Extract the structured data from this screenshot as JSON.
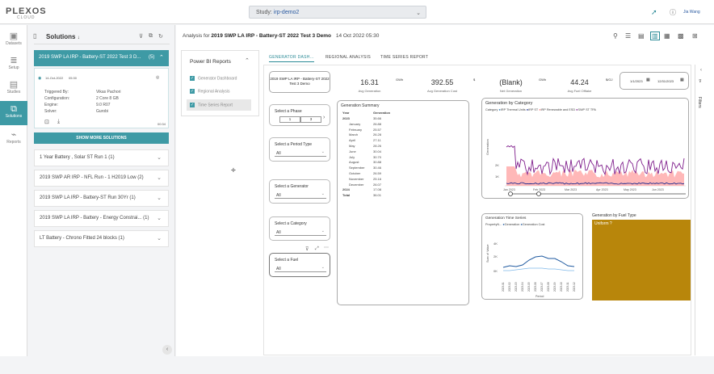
{
  "app": {
    "logo": "PLEXOS",
    "logo_sub": "CLOUD",
    "study_label": "Study:",
    "study_value": "irp-demo2",
    "user": "Jia Wang"
  },
  "nav": [
    {
      "label": "Datasets",
      "icon": "datasets-icon"
    },
    {
      "label": "Setup",
      "icon": "setup-icon"
    },
    {
      "label": "Studies",
      "icon": "studies-icon"
    },
    {
      "label": "Solutions",
      "icon": "solutions-icon"
    },
    {
      "label": "Reports",
      "icon": "reports-icon"
    }
  ],
  "solutions": {
    "title": "Solutions",
    "selected": {
      "title": "2019 SWP LA IRP - Battery-ST 2022 Test 3 D...",
      "count": "(5)",
      "date": "14-Oct-2022",
      "time": "05:30",
      "triggered_by_label": "Triggered By:",
      "triggered_by": "Vikas Pachori",
      "configuration_label": "Configuration:",
      "configuration": "2 Core 8 GB",
      "engine_label": "Engine:",
      "engine": "9.0 R07",
      "solver_label": "Solver:",
      "solver": "Gurobi",
      "duration": "00:34"
    },
    "show_more": "SHOW MORE SOLUTIONS",
    "items": [
      {
        "label": "1 Year Battery , Solar ST Run 1 (1)"
      },
      {
        "label": "2019 SWP AR IRP - NFL Run - 1 H2019 Low (2)"
      },
      {
        "label": "2019 SWP LA IRP - Battery-ST Run 30Yr (1)"
      },
      {
        "label": "2019 SWP LA IRP - Battery - Energy Constrai... (1)"
      },
      {
        "label": "LT Battery - Chrono Fitted 24 blocks (1)"
      }
    ]
  },
  "analysis": {
    "prefix": "Analysis for",
    "title": "2019 SWP LA IRP - Battery-ST 2022 Test 3 Demo",
    "date": "14 Oct 2022 05:30"
  },
  "powerbi": {
    "title": "Power BI Reports",
    "items": [
      {
        "label": "Generator Dashboard"
      },
      {
        "label": "Regional Analysis"
      },
      {
        "label": "Time Series Report"
      }
    ]
  },
  "tabs": [
    {
      "label": "GENERATOR DASH..."
    },
    {
      "label": "REGIONAL ANALYSIS"
    },
    {
      "label": "TIME SERIES REPORT"
    }
  ],
  "report": {
    "model_box": "2019 SWP LA IRP - Battery-ST 2022 Test 3 Demo",
    "kpis": [
      {
        "value": "16.31",
        "unit": "GWh",
        "label": "Avg Generation"
      },
      {
        "value": "392.55",
        "unit": "$",
        "label": "Avg Generation Cost"
      },
      {
        "value": "(Blank)",
        "unit": "GWh",
        "label": "Net Generation"
      },
      {
        "value": "44.24",
        "unit": "$/GJ",
        "label": "Avg Fuel Offtake"
      }
    ],
    "date_from": "1/1/2023",
    "date_to": "12/31/2023",
    "phase": {
      "title": "Select a Phase",
      "opt1": "1",
      "opt2": "3"
    },
    "period": {
      "title": "Select a Period Type",
      "value": "All"
    },
    "generator": {
      "title": "Select a Generator",
      "value": "All"
    },
    "category": {
      "title": "Select a Category",
      "value": "All"
    },
    "fuel": {
      "title": "Select a Fuel",
      "value": "All"
    },
    "gen_summary": {
      "title": "Generation Summary",
      "col_year": "Year",
      "col_gen": "Generation",
      "rows": [
        {
          "label": "2023",
          "value": "35.66"
        },
        {
          "label": "January",
          "value": "26.88"
        },
        {
          "label": "February",
          "value": "25.57"
        },
        {
          "label": "March",
          "value": "26.28"
        },
        {
          "label": "April",
          "value": "27.11"
        },
        {
          "label": "May",
          "value": "28.26"
        },
        {
          "label": "June",
          "value": "30.04"
        },
        {
          "label": "July",
          "value": "30.70"
        },
        {
          "label": "August",
          "value": "30.88"
        },
        {
          "label": "September",
          "value": "30.46"
        },
        {
          "label": "October",
          "value": "26.59"
        },
        {
          "label": "November",
          "value": "25.16"
        },
        {
          "label": "December",
          "value": "26.07"
        },
        {
          "label": "2024",
          "value": "17.08"
        },
        {
          "label": "Total",
          "value": "36.01"
        }
      ]
    },
    "gen_by_category": {
      "title": "Generation by Category",
      "legend_title": "Category",
      "legend": [
        "IRP Thermal Units",
        "IRP ST",
        "IRP Renewable and ESD",
        "SWP ST TPA"
      ],
      "colors": [
        "#1f77b4",
        "#0b1f8c",
        "#ff7f7f",
        "#7f1e8c"
      ],
      "y_axis": "Generation",
      "y_ticks": [
        "2K",
        "1K"
      ],
      "x_ticks": [
        "Jan 2023",
        "Feb 2023",
        "Mar 2023",
        "Apr 2023",
        "May 2023",
        "Jun 2023"
      ]
    },
    "gen_time_series": {
      "title": "Generation Time Series",
      "legend_title": "PropertyN...",
      "legend": [
        "Generation",
        "Generation Cost"
      ],
      "y_axis": "Sum of Value",
      "y_ticks": [
        "4K",
        "2K",
        "0K"
      ],
      "x_label": "Period",
      "x_ticks": [
        "2023-01",
        "2023-02",
        "2023-03",
        "2023-04",
        "2023-05",
        "2023-06",
        "2023-07",
        "2023-08",
        "2023-09",
        "2023-10",
        "2023-11",
        "2023-12"
      ],
      "colors": [
        "#1f5aa0",
        "#7fb8e8"
      ]
    },
    "gen_by_fuel": {
      "title": "Generation by Fuel Type",
      "label": "Uniform ?",
      "color": "#b8860b"
    },
    "filters_label": "Filters"
  }
}
